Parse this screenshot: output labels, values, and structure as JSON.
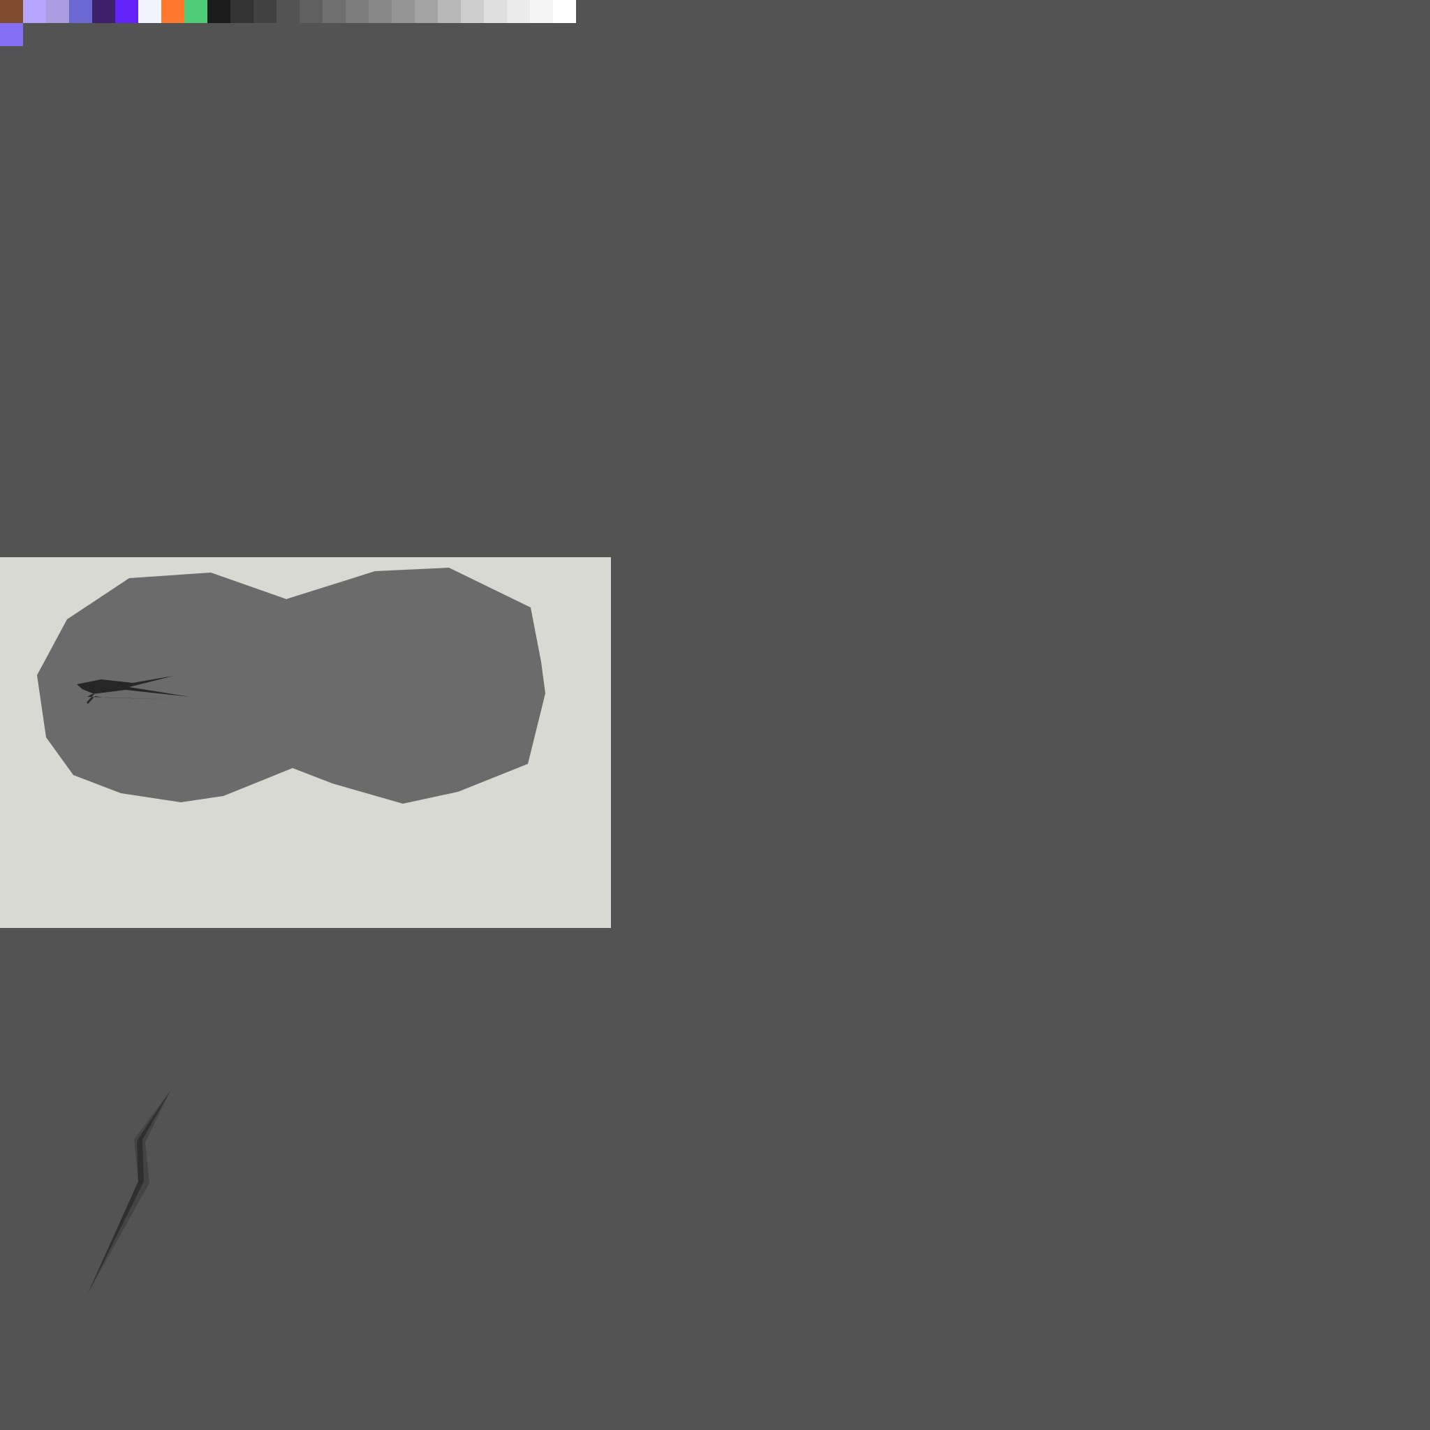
{
  "palette": {
    "swatches": [
      {
        "name": "brown",
        "color": "#7f4a2d"
      },
      {
        "name": "lavender-light",
        "color": "#b5a6fb"
      },
      {
        "name": "lavender",
        "color": "#ab9bdf"
      },
      {
        "name": "slate-blue",
        "color": "#6868d0"
      },
      {
        "name": "deep-purple",
        "color": "#3b1f6d"
      },
      {
        "name": "violet",
        "color": "#6322f7"
      },
      {
        "name": "off-white-blue",
        "color": "#f1f4ff"
      },
      {
        "name": "orange",
        "color": "#ff7a2c"
      },
      {
        "name": "green",
        "color": "#4fcc78"
      },
      {
        "name": "near-black",
        "color": "#1b1b1b"
      },
      {
        "name": "charcoal",
        "color": "#333333"
      },
      {
        "name": "dark-gray",
        "color": "#414141"
      },
      {
        "name": "gray-535353",
        "color": "#535353"
      },
      {
        "name": "gray-5f5f5f",
        "color": "#5f5f5f"
      },
      {
        "name": "gray-6f6f6f",
        "color": "#6f6f6f"
      },
      {
        "name": "gray-7c7c7c",
        "color": "#7c7c7c"
      },
      {
        "name": "gray-878787",
        "color": "#878787"
      },
      {
        "name": "gray-959595",
        "color": "#959595"
      },
      {
        "name": "gray-a3a3a3",
        "color": "#a3a3a3"
      },
      {
        "name": "gray-b8b8b8",
        "color": "#b8b8b8"
      },
      {
        "name": "gray-cecece",
        "color": "#cecece"
      },
      {
        "name": "gray-dfdfdf",
        "color": "#dfdfdf"
      },
      {
        "name": "gray-ebebeb",
        "color": "#ebebeb"
      },
      {
        "name": "gray-f5f5f5",
        "color": "#f5f5f5"
      },
      {
        "name": "white",
        "color": "#ffffff"
      }
    ],
    "selected": {
      "name": "selected-color",
      "color": "#8570f5"
    }
  },
  "canvas": {
    "background": "#d9d9d4",
    "blob_color": "#6b6b6b",
    "scribble_color": "#262626"
  },
  "loose_stroke": {
    "dark": "#2f2f2f",
    "light": "#444444"
  },
  "workspace_color": "#535353"
}
